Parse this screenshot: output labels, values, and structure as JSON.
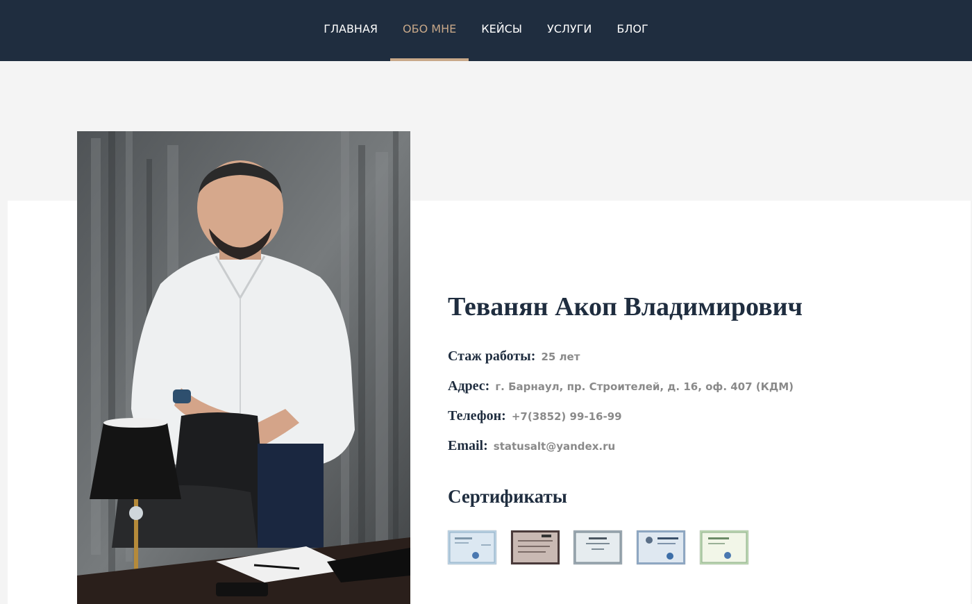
{
  "nav": {
    "items": [
      {
        "label": "ГЛАВНАЯ"
      },
      {
        "label": "ОБО МНЕ"
      },
      {
        "label": "КЕЙСЫ"
      },
      {
        "label": "УСЛУГИ"
      },
      {
        "label": "БЛОГ"
      }
    ],
    "active_index": 1
  },
  "profile": {
    "name": "Теванян Акоп Владимирович",
    "experience": {
      "label": "Стаж работы:",
      "value": "25 лет"
    },
    "address": {
      "label": "Адрес:",
      "value": "г. Барнаул, пр. Строителей, д. 16, оф. 407 (КДМ)"
    },
    "phone": {
      "label": "Телефон:",
      "value": "+7(3852) 99-16-99"
    },
    "email": {
      "label": "Email:",
      "value": "statusalt@yandex.ru"
    }
  },
  "certificates": {
    "title": "Сертификаты",
    "count": 5
  },
  "colors": {
    "nav_bg": "#1f2d3f",
    "accent": "#c8a889",
    "heading": "#1f2d3f",
    "value_text": "#8a8a8a"
  }
}
